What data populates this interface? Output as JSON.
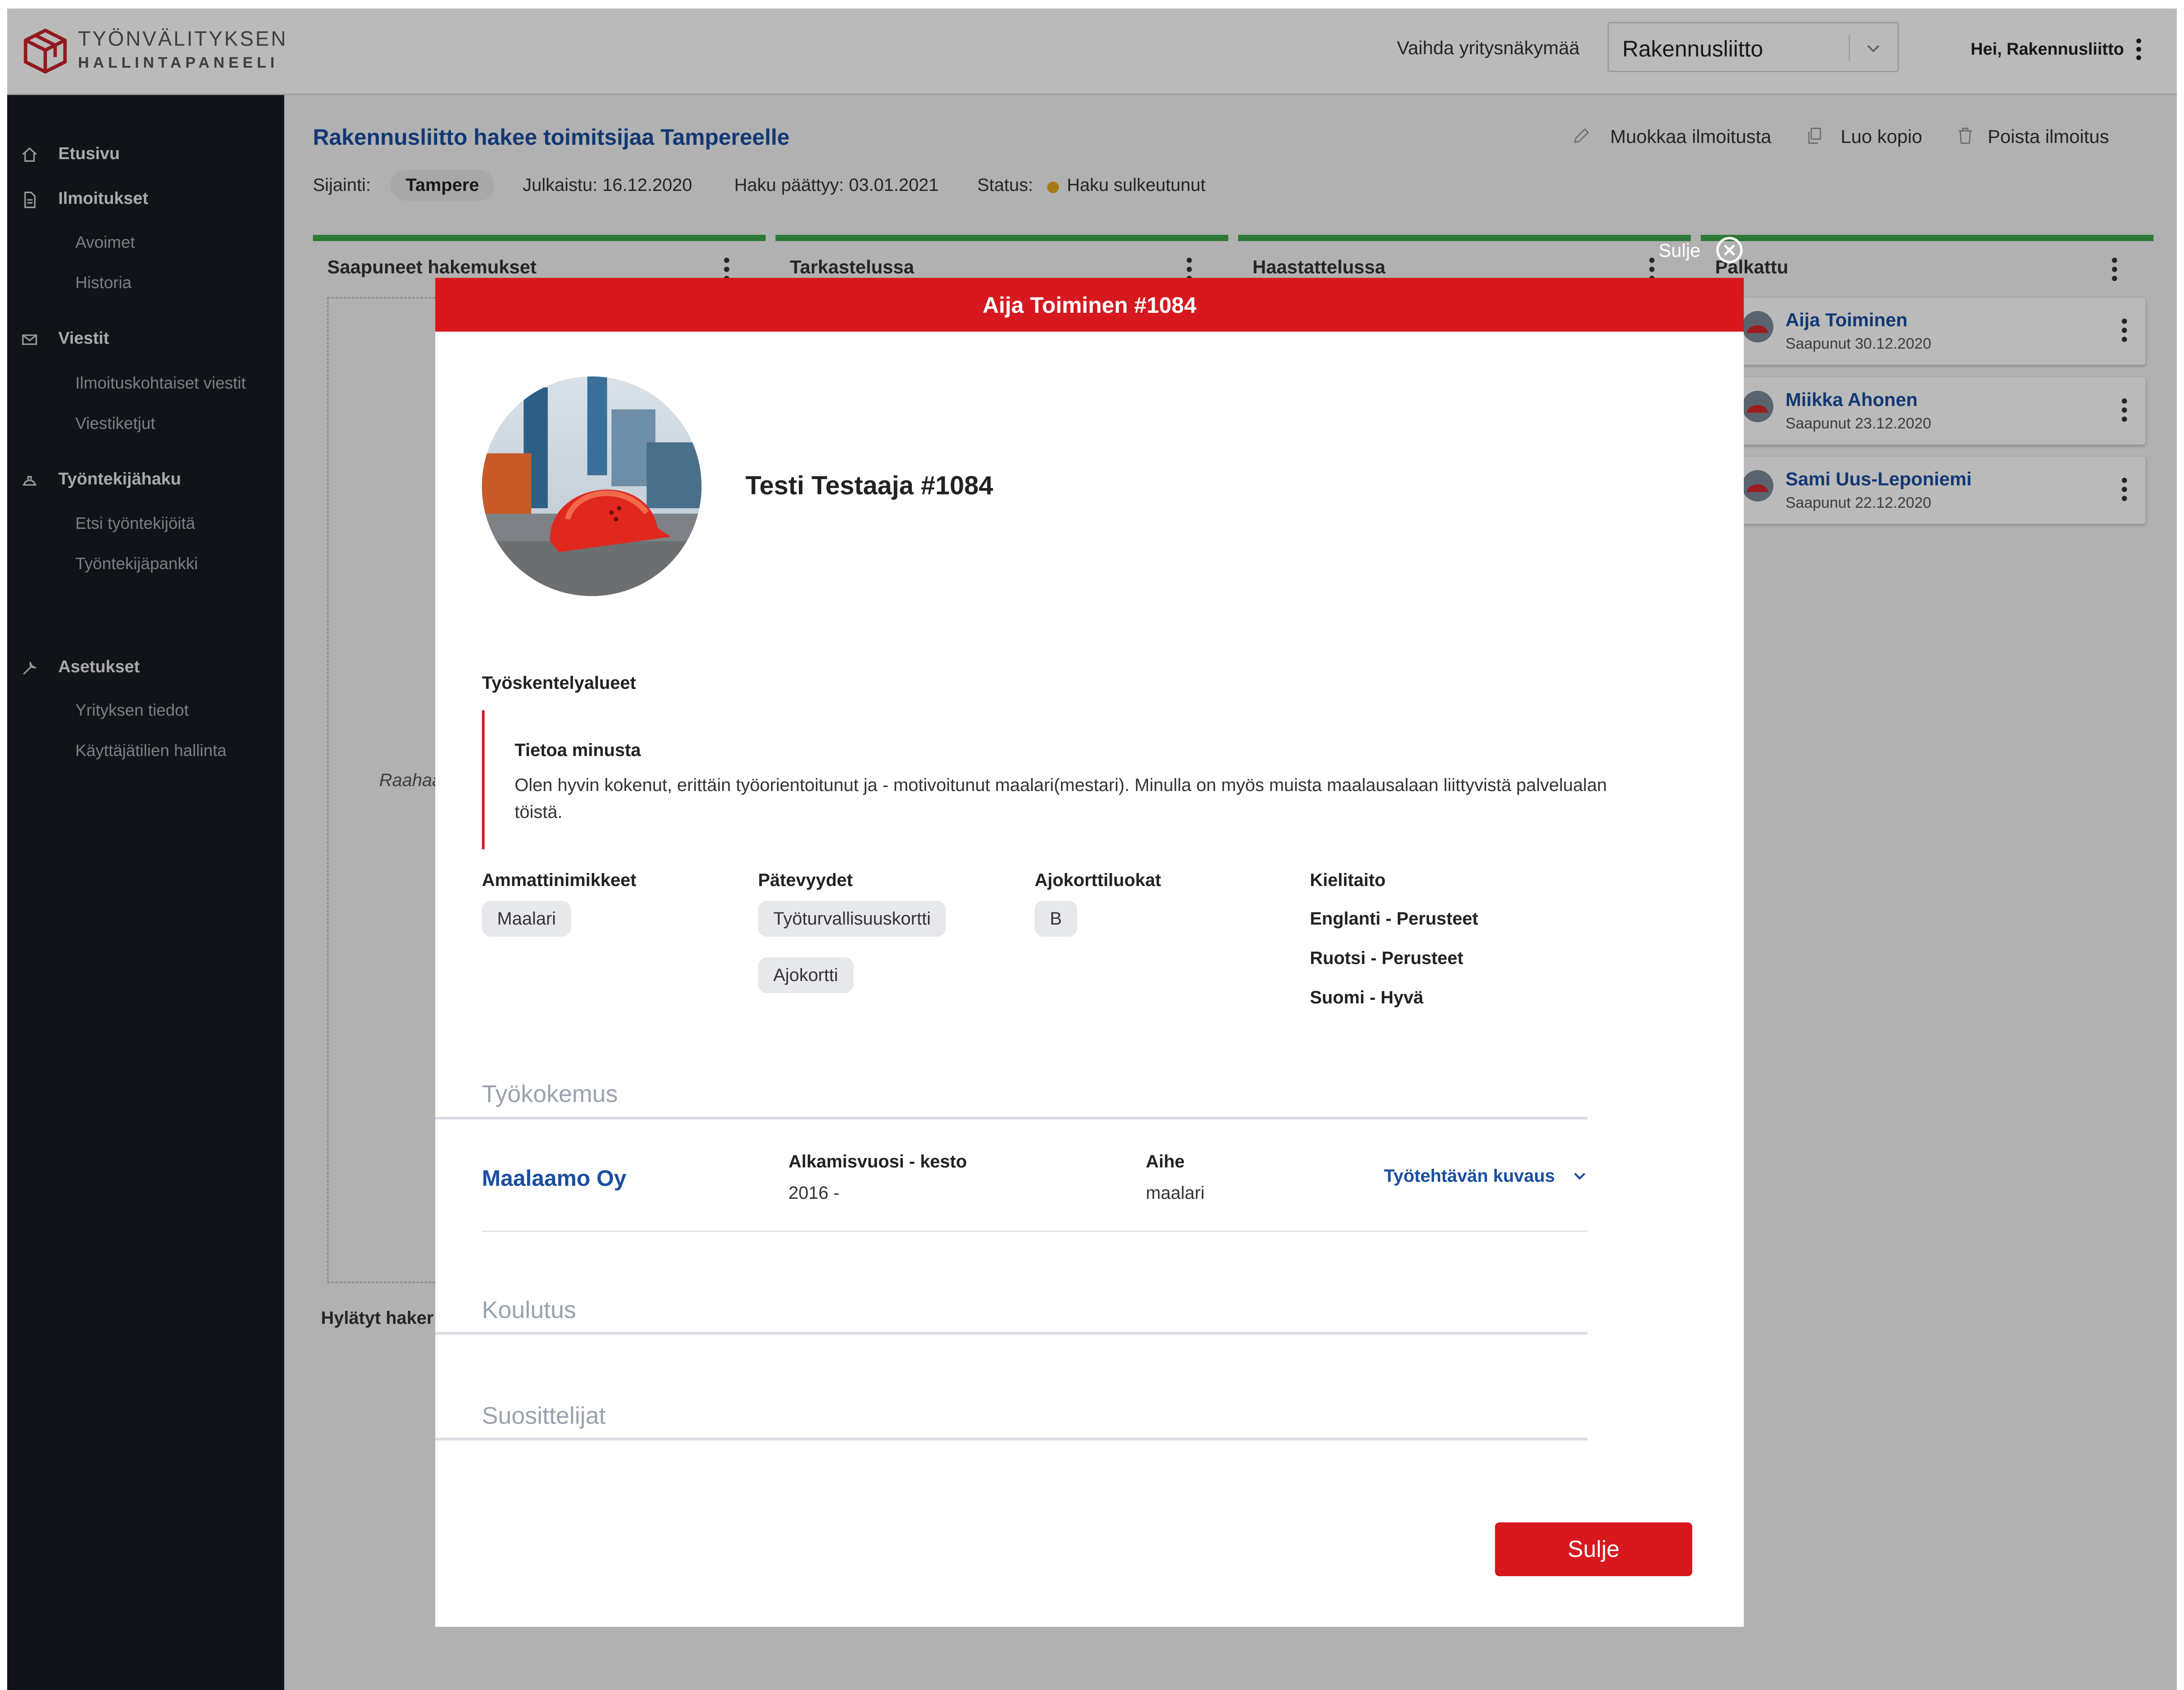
{
  "header": {
    "logo_line1": "TYÖNVÄLITYKSEN",
    "logo_line2": "HALLINTAPANEELI",
    "switch_label": "Vaihda yritysnäkymää",
    "company_selected": "Rakennusliitto",
    "greeting": "Hei, Rakennusliitto"
  },
  "sidebar": {
    "etusivu": "Etusivu",
    "ilmoitukset": "Ilmoitukset",
    "avoimet": "Avoimet",
    "historia": "Historia",
    "viestit": "Viestit",
    "ilmoituskohtaiset": "Ilmoituskohtaiset viestit",
    "viestiketjut": "Viestiketjut",
    "tyontekijahaku": "Työntekijähaku",
    "etsi": "Etsi työntekijöitä",
    "tyontekijapankki": "Työntekijäpankki",
    "asetukset": "Asetukset",
    "yrityksen_tiedot": "Yrityksen tiedot",
    "kayttajatilit": "Käyttäjätilien hallinta"
  },
  "job": {
    "title": "Rakennusliitto hakee toimitsijaa Tampereelle",
    "location_label": "Sijainti:",
    "location": "Tampere",
    "published": "Julkaistu: 16.12.2020",
    "deadline": "Haku päättyy: 03.01.2021",
    "status_label": "Status:",
    "status": "Haku sulkeutunut",
    "actions": {
      "edit": "Muokkaa ilmoitusta",
      "copy": "Luo kopio",
      "delete": "Poista ilmoitus"
    }
  },
  "board": {
    "columns": [
      "Saapuneet hakemukset",
      "Tarkastelussa",
      "Haastattelussa",
      "Palkattu"
    ],
    "dropzone_hint": "Raahaa",
    "rejected_label": "Hylätyt haker",
    "hired": [
      {
        "name": "Aija Toiminen",
        "date": "Saapunut 30.12.2020"
      },
      {
        "name": "Miikka Ahonen",
        "date": "Saapunut 23.12.2020"
      },
      {
        "name": "Sami Uus-Leponiemi",
        "date": "Saapunut 22.12.2020"
      }
    ]
  },
  "modal": {
    "close_label": "Sulje",
    "title": "Aija Toiminen #1084",
    "candidate_name": "Testi Testaaja #1084",
    "work_areas_label": "Työskentelyalueet",
    "about_title": "Tietoa minusta",
    "about_text": "Olen hyvin kokenut, erittäin työorientoitunut ja - motivoitunut maalari(mestari). Minulla on myös muista maalausalaan liittyvistä palvelualan töistä.",
    "titles_label": "Ammattinimikkeet",
    "titles": [
      "Maalari"
    ],
    "qualifications_label": "Pätevyydet",
    "qualifications": [
      "Työturvallisuuskortti",
      "Ajokortti"
    ],
    "license_label": "Ajokorttiluokat",
    "licenses": [
      "B"
    ],
    "languages_label": "Kielitaito",
    "languages": [
      "Englanti - Perusteet",
      "Ruotsi - Perusteet",
      "Suomi - Hyvä"
    ],
    "experience_title": "Työkokemus",
    "experience": {
      "company": "Maalaamo Oy",
      "start_label": "Alkamisvuosi - kesto",
      "start_value": "2016 -",
      "topic_label": "Aihe",
      "topic_value": "maalari",
      "desc_toggle": "Työtehtävän kuvaus"
    },
    "education_title": "Koulutus",
    "references_title": "Suosittelijat",
    "close_button": "Sulje"
  },
  "icons": [
    "logo-icon",
    "chevron-down-icon",
    "kebab-menu-icon",
    "home-icon",
    "document-icon",
    "mail-icon",
    "helmet-icon",
    "tools-icon",
    "pencil-icon",
    "copy-icon",
    "trash-icon",
    "close-circle-icon"
  ],
  "colors": {
    "accent_red": "#d7181f",
    "link_blue": "#1a4ea0",
    "sidebar_bg": "#171c23",
    "column_green": "#3ea64a",
    "status_yellow": "#e7a621"
  }
}
